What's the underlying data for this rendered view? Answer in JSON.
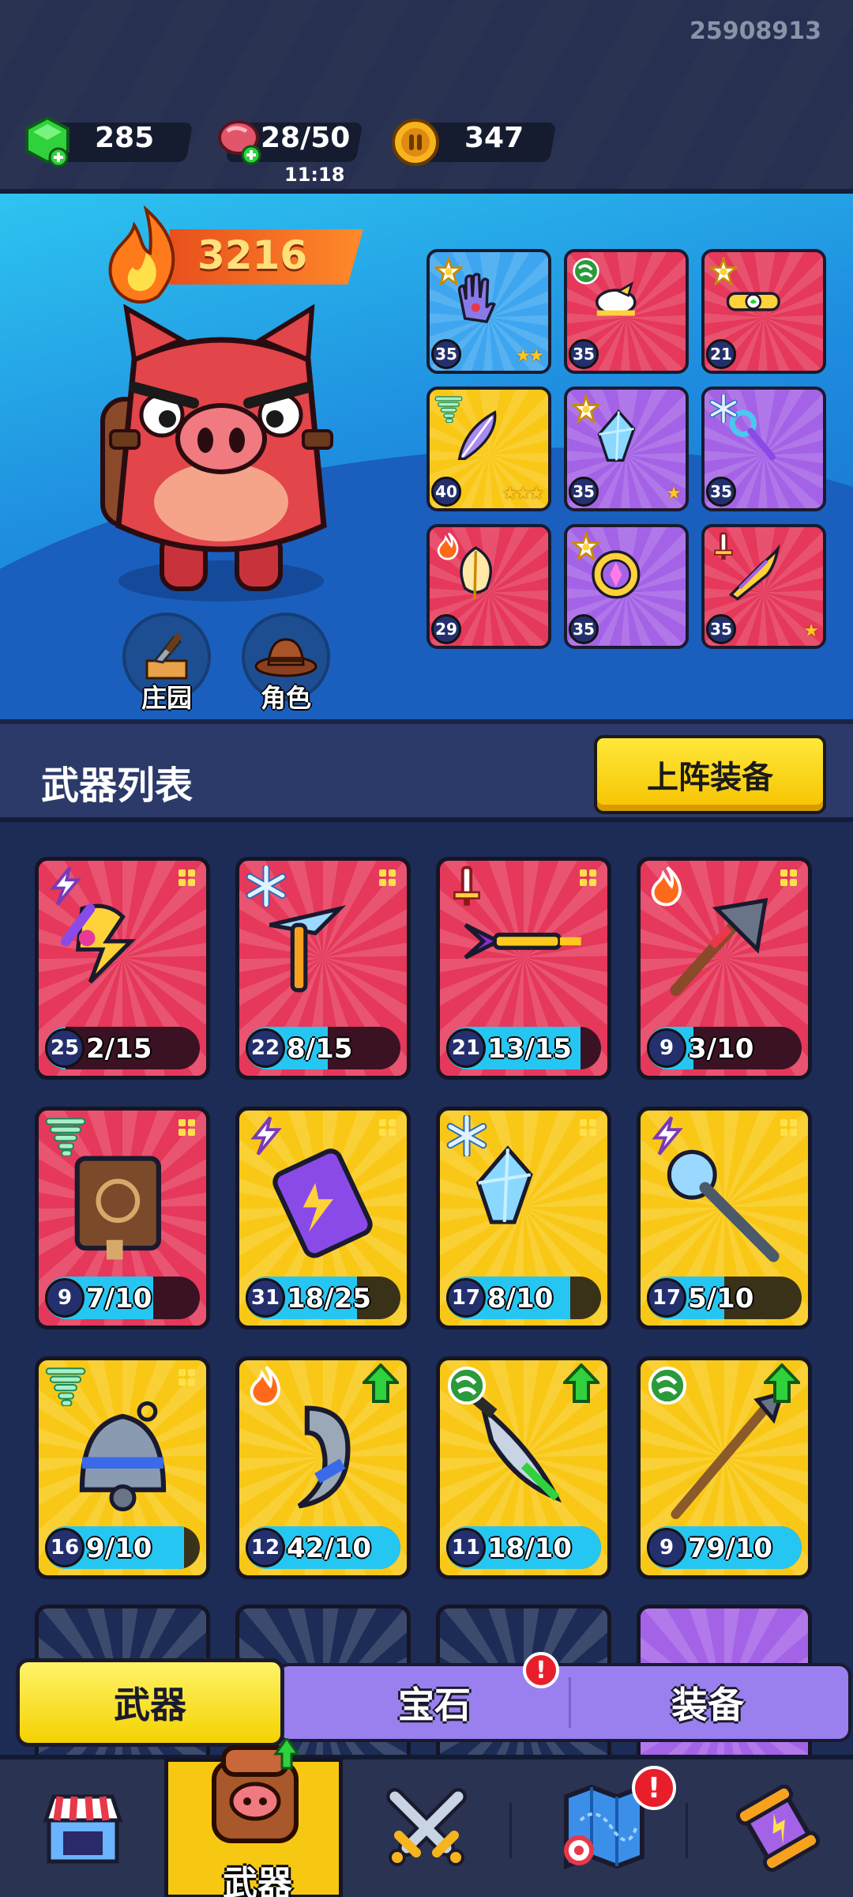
{
  "header": {
    "uid": "25908913",
    "gems": "285",
    "energy": "28/50",
    "energy_timer": "11:18",
    "coins": "347"
  },
  "hero": {
    "power": "3216",
    "shortcuts": [
      {
        "label": "庄园",
        "icon": "manor-icon"
      },
      {
        "label": "角色",
        "icon": "character-hat-icon"
      }
    ],
    "equipped": [
      {
        "level": "35",
        "color": "#3ea6f0",
        "element": "star",
        "item": "glove",
        "stars": "★★"
      },
      {
        "level": "35",
        "color": "#e5385a",
        "element": "wind",
        "item": "bird",
        "stars": ""
      },
      {
        "level": "21",
        "color": "#e5385a",
        "element": "star",
        "item": "belt",
        "stars": ""
      },
      {
        "level": "40",
        "color": "#f9c816",
        "element": "tornado",
        "item": "feather",
        "stars": "★★★"
      },
      {
        "level": "35",
        "color": "#a463e6",
        "element": "star",
        "item": "crystal",
        "stars": "★"
      },
      {
        "level": "35",
        "color": "#a463e6",
        "element": "ice",
        "item": "scepter",
        "stars": ""
      },
      {
        "level": "29",
        "color": "#e5385a",
        "element": "fire",
        "item": "leaf",
        "stars": ""
      },
      {
        "level": "35",
        "color": "#a463e6",
        "element": "star",
        "item": "amulet",
        "stars": ""
      },
      {
        "level": "35",
        "color": "#e5385a",
        "element": "sword",
        "item": "blade",
        "stars": "★"
      }
    ]
  },
  "weapon_list": {
    "title": "武器列表",
    "deploy_button": "上阵装备",
    "items": [
      {
        "level": "25",
        "progress": "2/15",
        "progress_frac": 0.133,
        "color": "red",
        "element": "lightning",
        "item": "lightning"
      },
      {
        "level": "22",
        "progress": "8/15",
        "progress_frac": 0.533,
        "color": "red",
        "element": "ice",
        "item": "icepick"
      },
      {
        "level": "21",
        "progress": "13/15",
        "progress_frac": 0.867,
        "color": "red",
        "element": "sword",
        "item": "trident"
      },
      {
        "level": "9",
        "progress": "3/10",
        "progress_frac": 0.3,
        "color": "red",
        "element": "fire",
        "item": "axe"
      },
      {
        "level": "9",
        "progress": "7/10",
        "progress_frac": 0.7,
        "color": "red",
        "element": "tornado",
        "item": "book"
      },
      {
        "level": "31",
        "progress": "18/25",
        "progress_frac": 0.72,
        "color": "yel",
        "element": "lightning",
        "item": "battery"
      },
      {
        "level": "17",
        "progress": "8/10",
        "progress_frac": 0.8,
        "color": "yel",
        "element": "ice",
        "item": "crystal"
      },
      {
        "level": "17",
        "progress": "5/10",
        "progress_frac": 0.5,
        "color": "yel",
        "element": "lightning",
        "item": "staff"
      },
      {
        "level": "16",
        "progress": "9/10",
        "progress_frac": 0.9,
        "color": "yel",
        "element": "tornado",
        "item": "bell",
        "upgrade": false
      },
      {
        "level": "12",
        "progress": "42/10",
        "progress_frac": 1.0,
        "color": "yel",
        "element": "fire",
        "item": "hook",
        "upgrade": true
      },
      {
        "level": "11",
        "progress": "18/10",
        "progress_frac": 1.0,
        "color": "yel",
        "element": "wind",
        "item": "dagger",
        "upgrade": true
      },
      {
        "level": "9",
        "progress": "79/10",
        "progress_frac": 1.0,
        "color": "yel",
        "element": "wind",
        "item": "spear",
        "upgrade": true
      }
    ]
  },
  "category_tabs": {
    "weapons": "武器",
    "gems": "宝石",
    "equipment": "装备",
    "gems_badge": "!"
  },
  "bottom_nav": {
    "active_label": "武器",
    "map_badge": "!"
  },
  "colors": {
    "red_card": "#e5385a",
    "yellow_card": "#f9c816",
    "purple_card": "#a463e6",
    "progress_fill": "#26c6f2",
    "accent_yellow": "#f6c812"
  }
}
